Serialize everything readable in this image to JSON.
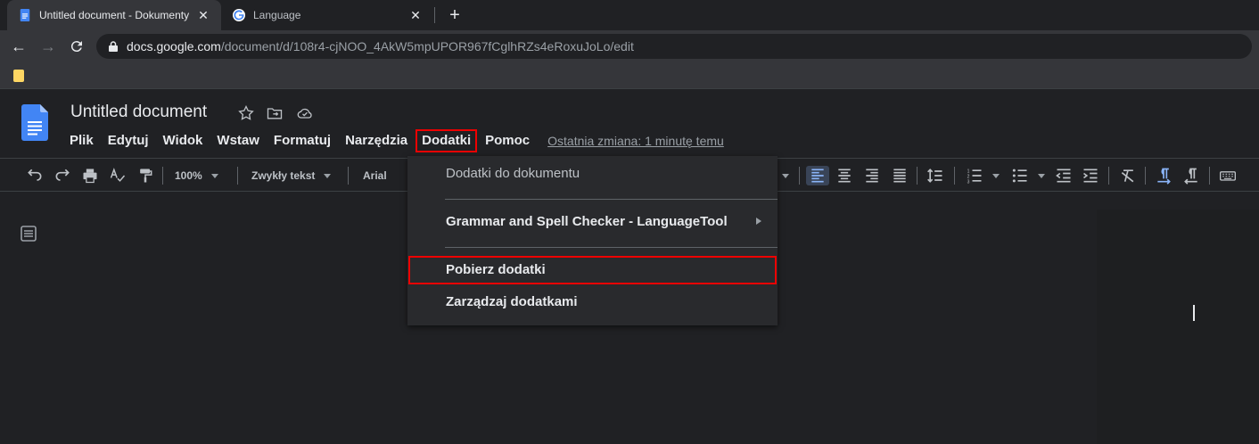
{
  "browser": {
    "tabs": [
      {
        "title": "Untitled document - Dokumenty",
        "active": true
      },
      {
        "title": "Language",
        "active": false
      }
    ],
    "url_host": "docs.google.com",
    "url_path": "/document/d/108r4-cjNOO_4AkW5mpUPOR967fCglhRZs4eRoxuJoLo/edit"
  },
  "doc": {
    "title": "Untitled document",
    "menu": [
      "Plik",
      "Edytuj",
      "Widok",
      "Wstaw",
      "Formatuj",
      "Narzędzia",
      "Dodatki",
      "Pomoc"
    ],
    "highlighted_menu": "Dodatki",
    "last_edit": "Ostatnia zmiana: 1 minutę temu"
  },
  "toolbar": {
    "zoom": "100%",
    "style": "Zwykły tekst",
    "font": "Arial"
  },
  "dropdown": {
    "items": [
      {
        "label": "Dodatki do dokumentu"
      },
      {
        "label": "Grammar and Spell Checker - LanguageTool"
      },
      {
        "label": "Pobierz dodatki"
      },
      {
        "label": "Zarządzaj dodatkami"
      }
    ]
  },
  "colors": {
    "highlight": "#ee0000",
    "docs_blue": "#4285f4",
    "active_toolbar": "#8ab4f8"
  }
}
